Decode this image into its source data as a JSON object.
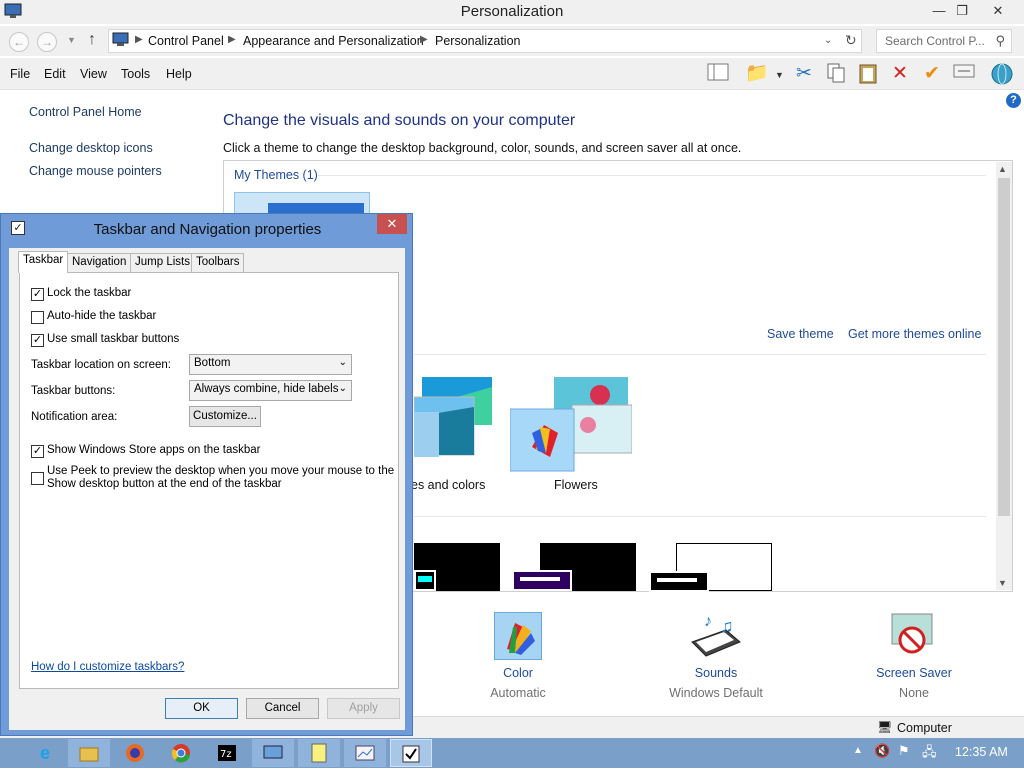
{
  "window": {
    "title": "Personalization",
    "minimize": "—",
    "maximize": "❐",
    "close": "✕"
  },
  "address": {
    "crumbs": [
      "Control Panel",
      "Appearance and Personalization",
      "Personalization"
    ],
    "search_placeholder": "Search Control P..."
  },
  "menu": [
    "File",
    "Edit",
    "View",
    "Tools",
    "Help"
  ],
  "left_pane": {
    "home": "Control Panel Home",
    "links": [
      "Change desktop icons",
      "Change mouse pointers"
    ]
  },
  "main": {
    "heading": "Change the visuals and sounds on your computer",
    "subtext": "Click a theme to change the desktop background, color, sounds, and screen saver all at once.",
    "my_themes": "My Themes (1)",
    "save_theme": "Save theme",
    "get_more": "Get more themes online",
    "theme_partial_label": "es and colors",
    "theme_flowers": "Flowers"
  },
  "bottom_items": [
    {
      "label": "Color",
      "sub": "Automatic",
      "icon": "color-palette-icon"
    },
    {
      "label": "Sounds",
      "sub": "Windows Default",
      "icon": "sounds-icon"
    },
    {
      "label": "Screen Saver",
      "sub": "None",
      "icon": "screen-saver-icon"
    }
  ],
  "statusbar": {
    "computer": "Computer"
  },
  "taskbar": {
    "clock": "12:35 AM"
  },
  "dialog": {
    "title": "Taskbar and Navigation properties",
    "tabs": [
      "Taskbar",
      "Navigation",
      "Jump Lists",
      "Toolbars"
    ],
    "options": {
      "lock": "Lock the taskbar",
      "autohide": "Auto-hide the taskbar",
      "small": "Use small taskbar buttons",
      "store": "Show Windows Store apps on the taskbar",
      "peek_line1": "Use Peek to preview the desktop when you move your mouse to the",
      "peek_line2": "Show desktop button at the end of the taskbar"
    },
    "location_label": "Taskbar location on screen:",
    "location_value": "Bottom",
    "buttons_label": "Taskbar buttons:",
    "buttons_value": "Always combine, hide labels",
    "notification_label": "Notification area:",
    "customize": "Customize...",
    "help_link": "How do I customize taskbars?",
    "ok": "OK",
    "cancel": "Cancel",
    "apply": "Apply"
  },
  "colors": {
    "accent_blue": "#1e3287",
    "dialog_frame": "#6f9bd8",
    "taskbar": "#7a9fc9",
    "close_red": "#c75050"
  }
}
